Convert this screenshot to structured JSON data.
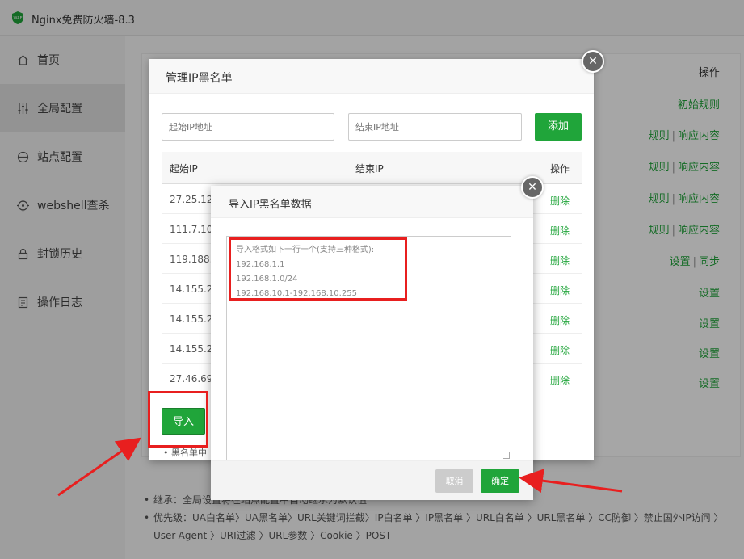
{
  "window": {
    "title": "Nginx免费防火墙-8.3"
  },
  "sidebar": {
    "items": [
      {
        "label": "首页",
        "icon": "home-icon"
      },
      {
        "label": "全局配置",
        "icon": "sliders-icon"
      },
      {
        "label": "站点配置",
        "icon": "globe-icon"
      },
      {
        "label": "webshell查杀",
        "icon": "target-icon"
      },
      {
        "label": "封锁历史",
        "icon": "lock-icon"
      },
      {
        "label": "操作日志",
        "icon": "document-icon"
      }
    ]
  },
  "main": {
    "ops_header": "操作",
    "ops_sep": "|",
    "ops": [
      {
        "a": "初始规则",
        "b": ""
      },
      {
        "a": "规则",
        "b": "响应内容"
      },
      {
        "a": "规则",
        "b": "响应内容"
      },
      {
        "a": "规则",
        "b": "响应内容"
      },
      {
        "a": "规则",
        "b": "响应内容"
      },
      {
        "a": "设置",
        "b": "同步"
      },
      {
        "a": "设置",
        "b": ""
      },
      {
        "a": "设置",
        "b": ""
      },
      {
        "a": "设置",
        "b": ""
      },
      {
        "a": "设置",
        "b": ""
      }
    ],
    "notes": [
      "继承：全局设置将在站点配置中自动继承为默认值",
      "优先级：UA白名单〉UA黑名单〉URL关键词拦截〉IP白名单 〉IP黑名单 〉URL白名单 〉URL黑名单 〉CC防御 〉禁止国外IP访问 〉User-Agent 〉URI过滤 〉URL参数 〉Cookie 〉POST"
    ]
  },
  "blacklist_modal": {
    "title": "管理IP黑名单",
    "start_placeholder": "起始IP地址",
    "end_placeholder": "结束IP地址",
    "add_label": "添加",
    "col_start": "起始IP",
    "col_end": "结束IP",
    "col_op": "操作",
    "delete_label": "删除",
    "rows": [
      "27.25.128",
      "111.7.100",
      "119.188.2",
      "14.155.20",
      "14.155.22",
      "14.155.20",
      "27.46.69."
    ],
    "import_label": "导入",
    "footnote": "• 黑名单中"
  },
  "import_modal": {
    "title": "导入IP黑名单数据",
    "placeholder_lines": [
      "导入格式如下一行一个(支持三种格式):",
      "192.168.1.1",
      "192.168.1.0/24",
      "192.168.10.1-192.168.10.255"
    ],
    "cancel_label": "取消",
    "confirm_label": "确定"
  },
  "colors": {
    "accent": "#20a53a",
    "highlight": "#e81f1f"
  }
}
